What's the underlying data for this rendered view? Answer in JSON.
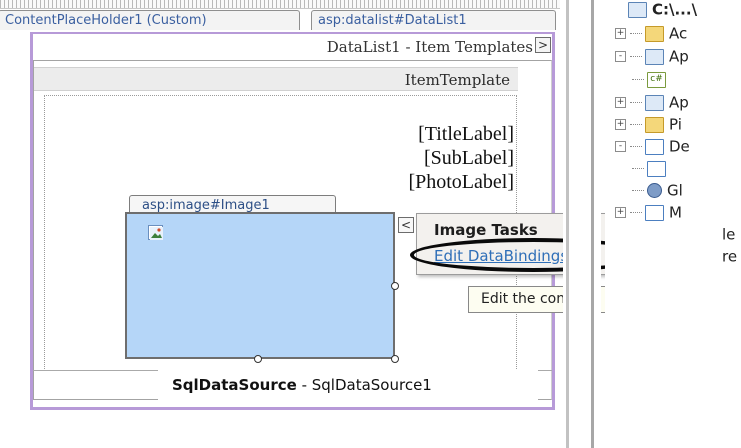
{
  "designer": {
    "content_tab": "ContentPlaceHolder1 (Custom)",
    "datalist_tab": "asp:datalist#DataList1",
    "datalist_header": "DataList1 - Item Templates",
    "smart_tag_arrow": ">",
    "item_template_header": "ItemTemplate",
    "fields": [
      "[TitleLabel]",
      "[SubLabel]",
      "[PhotoLabel]"
    ],
    "image_tab": "asp:image#Image1",
    "datasource_bold": "SqlDataSource",
    "datasource_rest": " - SqlDataSource1"
  },
  "image_tasks": {
    "arrow": "<",
    "title": "Image Tasks",
    "edit_link": "Edit DataBindings...",
    "tooltip": "Edit the control's DataBi"
  },
  "solution_explorer": {
    "rows": [
      {
        "text": "C:\\...\\",
        "icon": "project-icon",
        "expander": ""
      },
      {
        "text": "Ac",
        "icon": "folder-icon",
        "expander": "+"
      },
      {
        "text": "Ap",
        "icon": "folder-icon",
        "expander": "-"
      },
      {
        "text": "",
        "icon": "cs-file-icon",
        "expander": ""
      },
      {
        "text": "Ap",
        "icon": "folder-icon",
        "expander": "+"
      },
      {
        "text": "Pi",
        "icon": "folder-icon",
        "expander": "+"
      },
      {
        "text": "De",
        "icon": "page-icon",
        "expander": "-"
      },
      {
        "text": "",
        "icon": "page-icon",
        "expander": ""
      },
      {
        "text": "Gl",
        "icon": "gear-icon",
        "expander": ""
      },
      {
        "text": "M",
        "icon": "page-icon",
        "expander": "+"
      },
      {
        "text": "le",
        "icon": "page-icon",
        "expander": ""
      },
      {
        "text": "re",
        "icon": "page-icon",
        "expander": ""
      }
    ]
  },
  "colors": {
    "datalist_border": "#b79ad8",
    "image_fill": "#b5d6f8",
    "link": "#2f6fb8",
    "tooltip_bg": "#fdfdf1"
  }
}
